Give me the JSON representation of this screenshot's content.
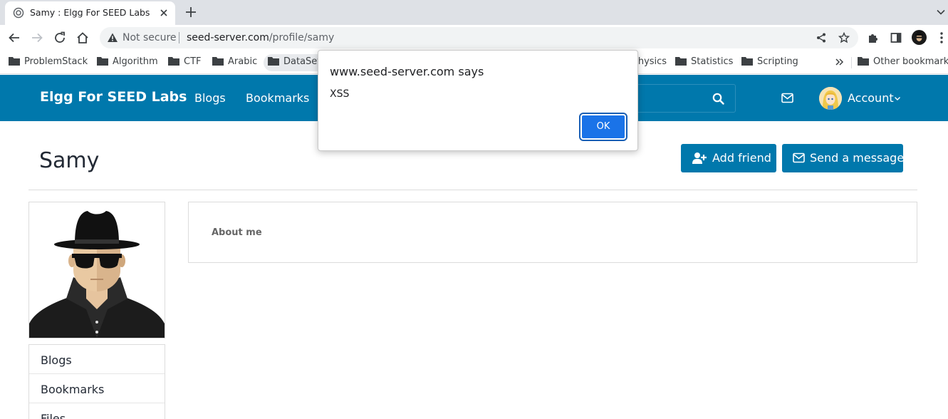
{
  "browser": {
    "tab_title": "Samy : Elgg For SEED Labs",
    "not_secure_label": "Not secure",
    "url_host": "seed-server.com",
    "url_path": "/profile/samy",
    "bookmarks": [
      "ProblemStack",
      "Algorithm",
      "CTF",
      "Arabic",
      "DataSets",
      "Physics",
      "Statistics",
      "Scripting"
    ],
    "other_bookmarks": "Other bookmarks"
  },
  "site": {
    "name": "Elgg For SEED Labs",
    "menu": [
      "Blogs",
      "Bookmarks"
    ],
    "account_label": "Account"
  },
  "profile": {
    "name": "Samy",
    "add_friend_label": "Add friend",
    "send_message_label": "Send a message",
    "about_label": "About me",
    "owner_menu": [
      "Blogs",
      "Bookmarks",
      "Files"
    ]
  },
  "dialog": {
    "title": "www.seed-server.com says",
    "message": "XSS",
    "ok_label": "OK"
  },
  "colors": {
    "elgg_blue": "#0078ac",
    "chrome_tabstrip": "#dee1e6",
    "dialog_button": "#1a73e8"
  }
}
